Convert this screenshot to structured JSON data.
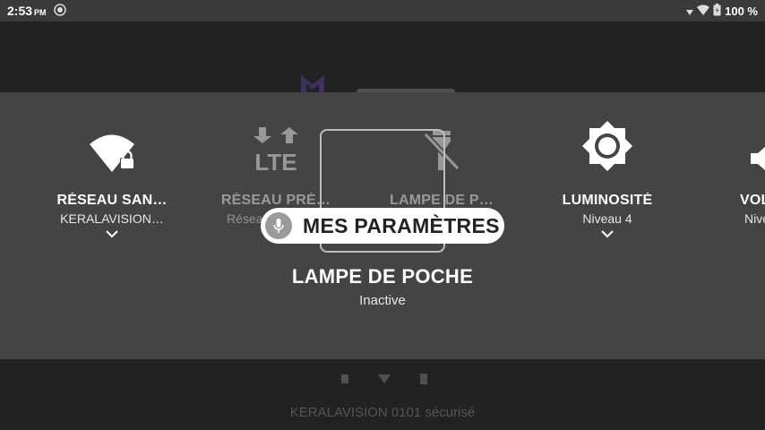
{
  "status_bar": {
    "time": "2:53",
    "ampm": "PM",
    "battery": "100 %"
  },
  "background_app": {
    "footer_text": "KERALAVISION 0101 sécurisé"
  },
  "tiles": [
    {
      "title": "RÉSEAU SAN…",
      "subtitle": "KERALAVISION…",
      "icon": "wifi-lock-icon"
    },
    {
      "title": "RÉSEAU PRÉ…",
      "subtitle": "Résea",
      "icon": "lte-data-icon"
    },
    {
      "title": "LAMPE DE P…",
      "subtitle": "",
      "icon": "flashlight-off-icon"
    },
    {
      "title": "LUMINOSITÉ",
      "subtitle": "Niveau 4",
      "icon": "brightness-icon"
    },
    {
      "title": "VOL",
      "subtitle": "Nive",
      "icon": "volume-icon"
    }
  ],
  "voice_pill": {
    "label": "MES PARAMÈTRES",
    "icon": "mic-icon"
  },
  "focused": {
    "title": "LAMPE DE POCHE",
    "status": "Inactive"
  }
}
